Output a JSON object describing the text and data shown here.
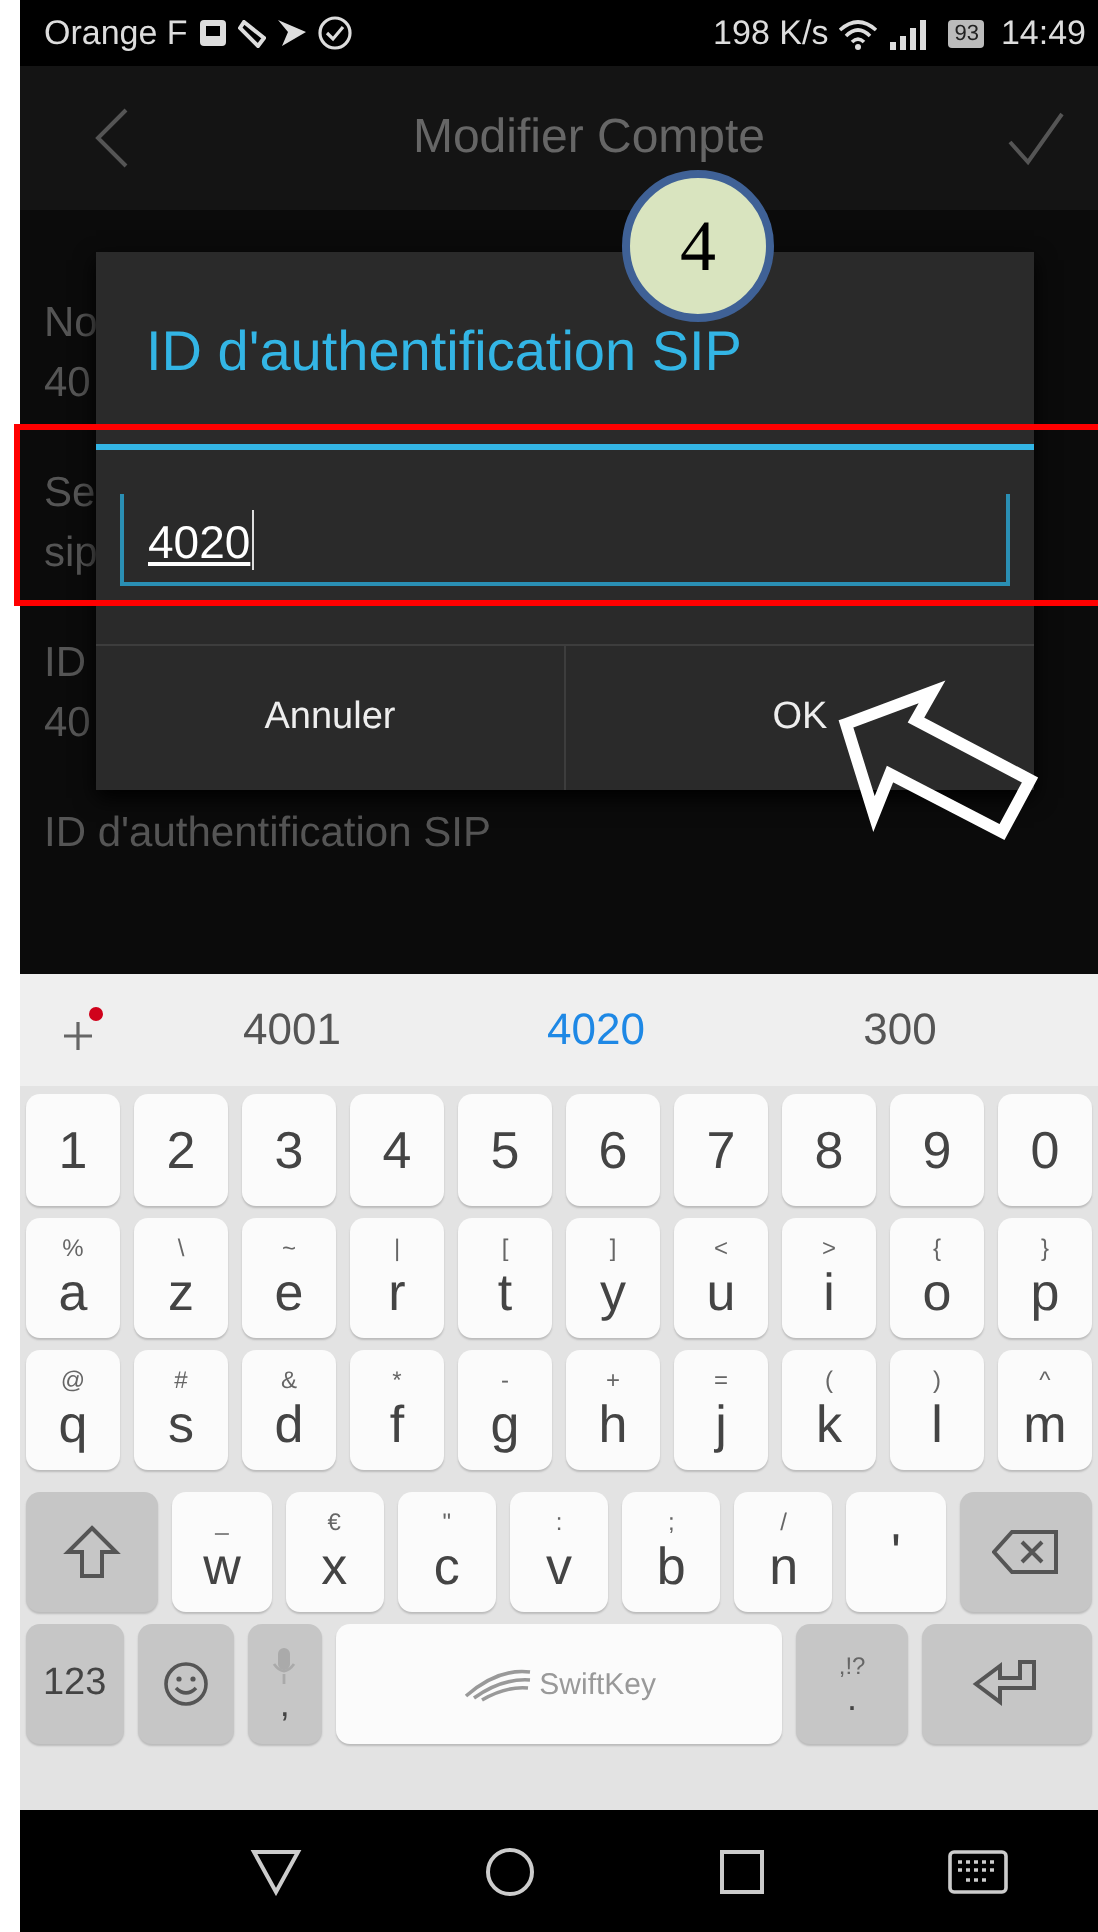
{
  "status_bar": {
    "carrier": "Orange F",
    "speed": "198 K/s",
    "battery": "93",
    "time": "14:49"
  },
  "app_bar": {
    "title": "Modifier Compte"
  },
  "settings": [
    {
      "label": "No",
      "value": "40"
    },
    {
      "label": "Se",
      "value": "sip"
    },
    {
      "label": "ID",
      "value": "40"
    },
    {
      "label": "ID d'authentification SIP"
    }
  ],
  "dialog": {
    "title": "ID d'authentification SIP",
    "value": "4020",
    "buttons": [
      "Annuler",
      "OK"
    ]
  },
  "step_badge": "4",
  "keyboard": {
    "suggestions": [
      {
        "text": "4001",
        "selected": false
      },
      {
        "text": "4020",
        "selected": true
      },
      {
        "text": "300",
        "selected": false
      }
    ],
    "rows": [
      {
        "keys": [
          {
            "kind": "char",
            "main": "1"
          },
          {
            "kind": "char",
            "main": "2"
          },
          {
            "kind": "char",
            "main": "3"
          },
          {
            "kind": "char",
            "main": "4"
          },
          {
            "kind": "char",
            "main": "5"
          },
          {
            "kind": "char",
            "main": "6"
          },
          {
            "kind": "char",
            "main": "7"
          },
          {
            "kind": "char",
            "main": "8"
          },
          {
            "kind": "char",
            "main": "9"
          },
          {
            "kind": "char",
            "main": "0"
          }
        ]
      },
      {
        "keys": [
          {
            "kind": "char",
            "hint": "%",
            "main": "a"
          },
          {
            "kind": "char",
            "hint": "\\",
            "main": "z"
          },
          {
            "kind": "char",
            "hint": "~",
            "main": "e"
          },
          {
            "kind": "char",
            "hint": "|",
            "main": "r"
          },
          {
            "kind": "char",
            "hint": "[",
            "main": "t"
          },
          {
            "kind": "char",
            "hint": "]",
            "main": "y"
          },
          {
            "kind": "char",
            "hint": "<",
            "main": "u"
          },
          {
            "kind": "char",
            "hint": ">",
            "main": "i"
          },
          {
            "kind": "char",
            "hint": "{",
            "main": "o"
          },
          {
            "kind": "char",
            "hint": "}",
            "main": "p"
          }
        ]
      },
      {
        "keys": [
          {
            "kind": "char",
            "hint": "@",
            "main": "q"
          },
          {
            "kind": "char",
            "hint": "#",
            "main": "s"
          },
          {
            "kind": "char",
            "hint": "&",
            "main": "d"
          },
          {
            "kind": "char",
            "hint": "*",
            "main": "f"
          },
          {
            "kind": "char",
            "hint": "-",
            "main": "g"
          },
          {
            "kind": "char",
            "hint": "+",
            "main": "h"
          },
          {
            "kind": "char",
            "hint": "=",
            "main": "j"
          },
          {
            "kind": "char",
            "hint": "(",
            "main": "k"
          },
          {
            "kind": "char",
            "hint": ")",
            "main": "l"
          },
          {
            "kind": "char",
            "hint": "^",
            "main": "m"
          }
        ]
      },
      {
        "keys": [
          {
            "kind": "shift"
          },
          {
            "kind": "char",
            "hint": "_",
            "main": "w"
          },
          {
            "kind": "char",
            "hint": "€",
            "main": "x"
          },
          {
            "kind": "char",
            "hint": "\"",
            "main": "c"
          },
          {
            "kind": "char",
            "hint": ":",
            "main": "v"
          },
          {
            "kind": "char",
            "hint": ";",
            "main": "b"
          },
          {
            "kind": "char",
            "hint": "/",
            "main": "n"
          },
          {
            "kind": "char",
            "main": "'"
          },
          {
            "kind": "backspace"
          }
        ]
      },
      {
        "keys": [
          {
            "kind": "symbols",
            "main": "123"
          },
          {
            "kind": "emoji"
          },
          {
            "kind": "mic",
            "main": ","
          },
          {
            "kind": "space"
          },
          {
            "kind": "punct",
            "hint": ",!?",
            "main": "."
          },
          {
            "kind": "enter"
          }
        ]
      }
    ],
    "space_logo": "SwiftKey"
  }
}
